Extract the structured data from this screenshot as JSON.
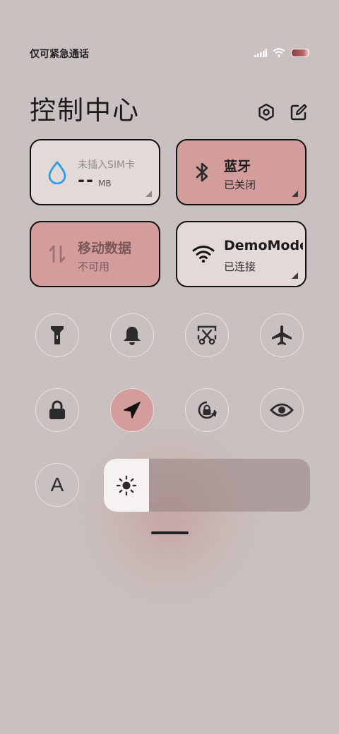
{
  "status_bar": {
    "carrier": "仅可紧急通话",
    "icons": [
      "signal-icon",
      "wifi-icon",
      "battery-icon"
    ]
  },
  "header": {
    "title": "控制中心",
    "settings_icon": "settings-icon",
    "edit_icon": "edit-icon"
  },
  "tiles": {
    "data_usage": {
      "label": "未插入SIM卡",
      "value": "--",
      "unit": "MB"
    },
    "bluetooth": {
      "label": "蓝牙",
      "status": "已关闭"
    },
    "mobile_data": {
      "label": "移动数据",
      "status": "不可用"
    },
    "wifi": {
      "label": "DemoMode",
      "status": "已连接"
    }
  },
  "quick_toggles": [
    "flashlight-icon",
    "bell-icon",
    "screenshot-icon",
    "airplane-icon",
    "lock-icon",
    "location-icon",
    "rotation-lock-icon",
    "eye-icon"
  ],
  "font_button": {
    "label": "A"
  },
  "brightness": {
    "level_fraction": 0.22
  },
  "colors": {
    "background": "#c9c1bf",
    "tile_active": "#d39d9d",
    "tile_inactive": "#e3dad8",
    "accent_blue": "#2d9be6"
  }
}
